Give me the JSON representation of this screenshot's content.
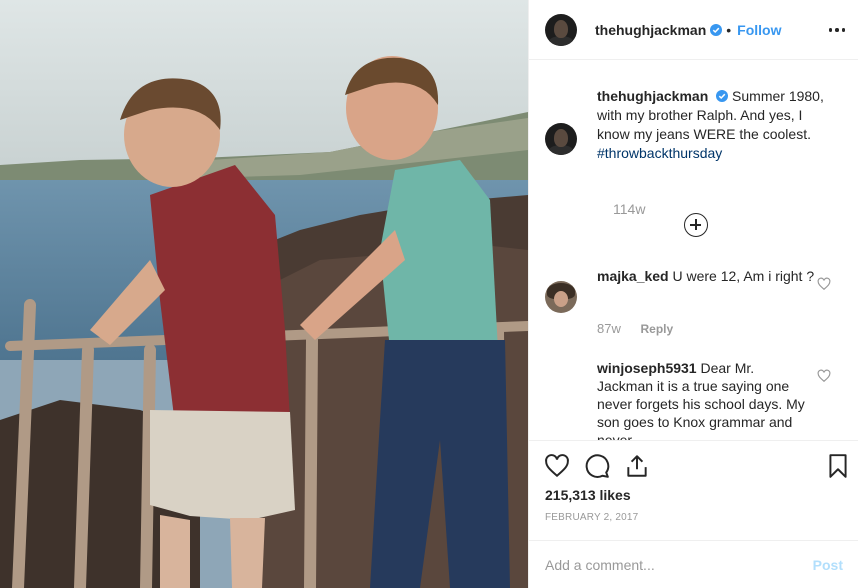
{
  "photo": {
    "icon": "photo-two-brothers-at-seaside-railing"
  },
  "header": {
    "username": "thehughjackman",
    "separator": "•",
    "follow_label": "Follow",
    "more_icon": "more-options-icon"
  },
  "caption": {
    "username": "thehughjackman",
    "text": "Summer 1980, with my brother Ralph. And yes, I know my jeans WERE the coolest.",
    "hashtag": "#throwbackthursday",
    "time_ago": "114w"
  },
  "comments": [
    {
      "username": "majka_ked",
      "text": "U were 12, Am i right ?",
      "time_ago": "87w",
      "reply_label": "Reply"
    },
    {
      "username": "winjoseph5931",
      "text": "Dear Mr. Jackman it is a true saying one never forgets his school days. My son goes to Knox grammar and never"
    }
  ],
  "post": {
    "likes": "215,313 likes",
    "date": "FEBRUARY 2, 2017"
  },
  "add_comment": {
    "placeholder": "Add a comment...",
    "post_label": "Post"
  },
  "colors": {
    "link_blue": "#3897f0",
    "hashtag": "#003569",
    "muted": "#999999",
    "post_disabled": "#b2dffc",
    "border": "#efefef"
  }
}
